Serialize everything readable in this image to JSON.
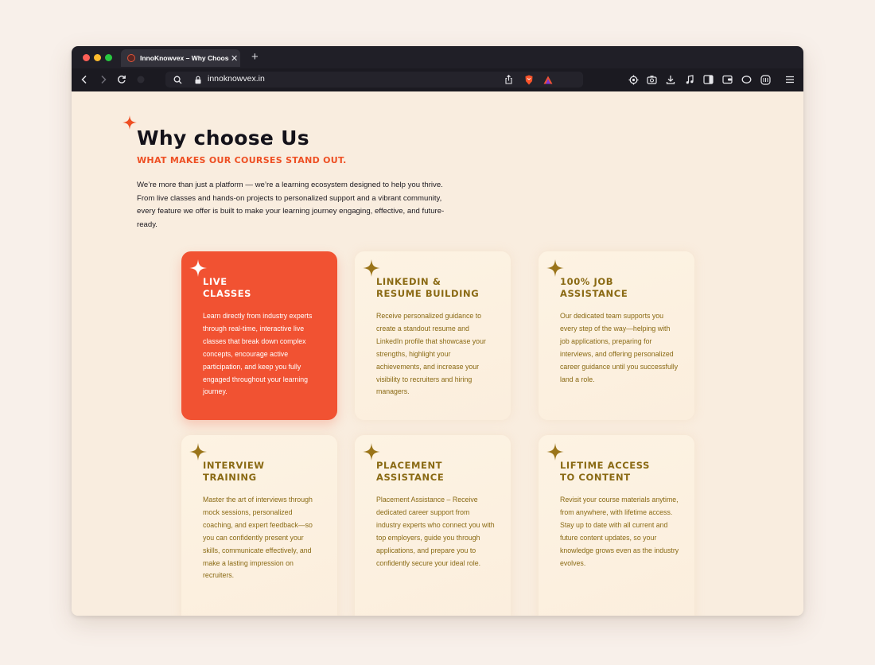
{
  "browser": {
    "tab_title": "InnoKnowvex – Why Choose Us",
    "tab_close": "✕",
    "new_tab": "+",
    "url": "innoknowvex.in"
  },
  "section": {
    "title": "Why choose Us",
    "subtitle": "WHAT MAKES OUR COURSES STAND OUT.",
    "intro": "We’re more than just a platform — we’re a learning ecosystem designed to help you thrive. From live classes and hands-on projects to personalized support and a vibrant community, every feature we offer is built to make your learning journey engaging, effective, and future-ready."
  },
  "cards": [
    {
      "title": "LIVE\nCLASSES",
      "description": "Learn directly from industry experts through real-time, interactive live classes that break down complex concepts, encourage active participation, and keep you fully engaged throughout your learning journey.",
      "highlighted": true
    },
    {
      "title": "LINKEDIN &\nRESUME BUILDING",
      "description": "Receive personalized guidance to create a standout resume and LinkedIn profile that showcase your strengths, highlight your achievements, and increase your visibility to recruiters and hiring managers.",
      "highlighted": false
    },
    {
      "title": "100% JOB\nASSISTANCE",
      "description": "Our dedicated team supports you every step of the way—helping with job applications, preparing for interviews, and offering personalized career guidance until you successfully land a role.",
      "highlighted": false
    },
    {
      "title": "INTERVIEW\nTRAINING",
      "description": "Master the art of interviews through mock sessions, personalized coaching, and expert feedback—so you can confidently present your skills, communicate effectively, and make a lasting impression on recruiters.",
      "highlighted": false
    },
    {
      "title": "PLACEMENT\nASSISTANCE",
      "description": "Placement Assistance – Receive dedicated career support from industry experts who connect you with top employers, guide you through applications, and prepare you to confidently secure your ideal role.",
      "highlighted": false
    },
    {
      "title": "LIFTIME ACCESS\nTO CONTENT",
      "description": "Revisit your course materials anytime, from anywhere, with lifetime access. Stay up to date with all current and future content updates, so your knowledge grows even as the industry evolves.",
      "highlighted": false
    }
  ],
  "colors": {
    "accent_orange": "#f15232",
    "card_text_gold": "#8a6a14",
    "sparkle_gold": "#9a7419",
    "page_background": "#f9eddf"
  },
  "icons": [
    "back-arrow-icon",
    "forward-arrow-icon",
    "reload-icon",
    "search-icon",
    "lock-icon",
    "share-icon",
    "brave-shield-icon",
    "brave-rewards-icon",
    "extensions-icon",
    "screenshot-icon",
    "download-icon",
    "music-icon",
    "sidebar-icon",
    "wallet-icon",
    "vpn-icon",
    "leo-icon",
    "menu-icon",
    "sparkle-icon"
  ]
}
